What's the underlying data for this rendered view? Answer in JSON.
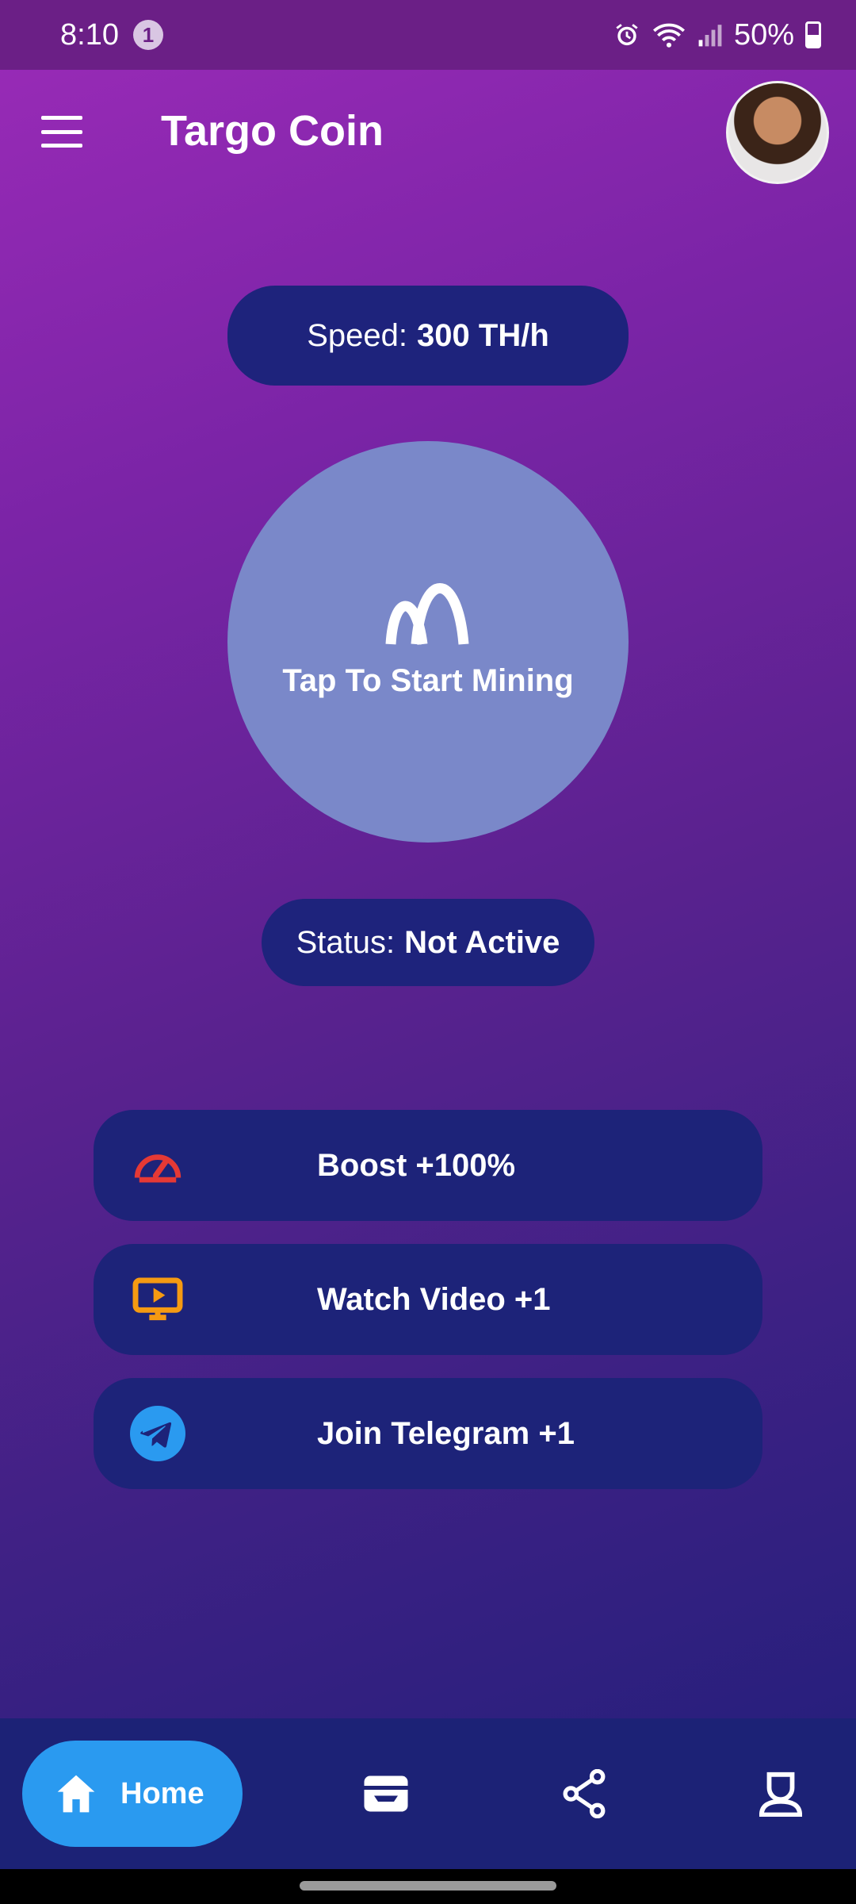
{
  "status_bar": {
    "time": "8:10",
    "notification_count": "1",
    "battery": "50%"
  },
  "app_bar": {
    "title": "Targo Coin"
  },
  "speed": {
    "label": "Speed:",
    "value": "300 TH/h"
  },
  "mining": {
    "button_label": "Tap To Start Mining"
  },
  "status": {
    "label": "Status:",
    "value": "Not Active"
  },
  "actions": [
    {
      "label": "Boost +100%",
      "icon": "speedometer-icon",
      "color": "#e53935"
    },
    {
      "label": "Watch Video +1",
      "icon": "tv-play-icon",
      "color": "#f59a12"
    },
    {
      "label": "Join Telegram +1",
      "icon": "telegram-icon",
      "color": "#2a9af0"
    }
  ],
  "bottom_nav": {
    "home_label": "Home",
    "items": [
      "home-icon",
      "wallet-icon",
      "share-icon",
      "profile-icon"
    ],
    "active_color": "#2a9af0"
  }
}
